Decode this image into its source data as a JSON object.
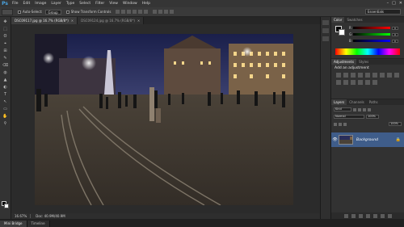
{
  "app": {
    "logo": "Ps"
  },
  "menu": [
    "File",
    "Edit",
    "Image",
    "Layer",
    "Type",
    "Select",
    "Filter",
    "View",
    "Window",
    "Help"
  ],
  "window_controls": [
    "–",
    "□",
    "✕"
  ],
  "options_bar": {
    "auto_select_label": "Auto-Select:",
    "auto_select_value": "Group",
    "show_transform_label": "Show Transform Controls",
    "workspace": "Essentials"
  },
  "tools": [
    "✥",
    "⬚",
    "ʘ",
    "⌖",
    "⊞",
    "✎",
    "⌫",
    "◍",
    "▲",
    "◐",
    "T",
    "↖",
    "▭",
    "✋",
    "⚲"
  ],
  "document_tabs": [
    {
      "label": "DSC09117.jpg @ 16.7% (RGB/8*)"
    },
    {
      "label": "DSC09124.jpg @ 16.7% (RGB/8*)"
    }
  ],
  "status": {
    "zoom": "16.67%",
    "doc_info": "Doc: 40.9M/40.9M"
  },
  "bottom_tabs": [
    "Mini Bridge",
    "Timeline"
  ],
  "color_panel": {
    "tabs": [
      "Color",
      "Swatches"
    ],
    "rows": [
      {
        "label": "R",
        "value": "0"
      },
      {
        "label": "G",
        "value": "0"
      },
      {
        "label": "B",
        "value": "0"
      }
    ]
  },
  "adjustments_panel": {
    "tabs": [
      "Adjustments",
      "Styles"
    ],
    "title": "Add an adjustment"
  },
  "layers_panel": {
    "tabs": [
      "Layers",
      "Channels",
      "Paths"
    ],
    "kind_select": "Kind",
    "blend_select": "Normal",
    "opacity": "100%",
    "fill": "100%",
    "layer_name": "Background",
    "lock_symbol": "🔒"
  },
  "colors": {
    "accent": "#3f5d8a",
    "ps_blue": "#4aa3df"
  }
}
